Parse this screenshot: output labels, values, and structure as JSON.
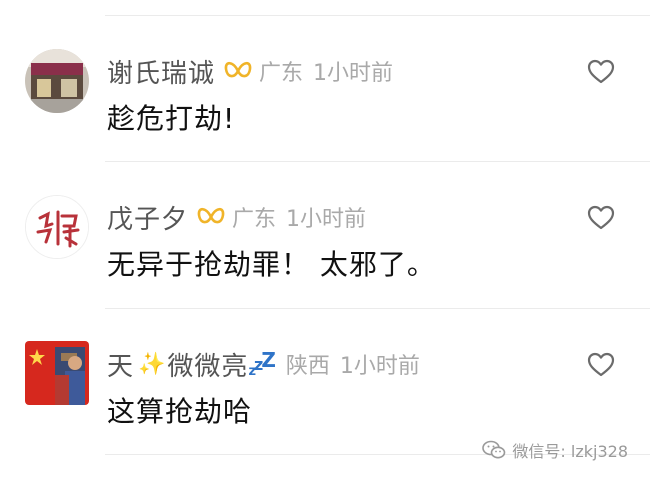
{
  "comments": [
    {
      "name": "谢氏瑞诚",
      "badge": "gold-ring-badge-icon",
      "location": "广东",
      "time": "1小时前",
      "text": "趁危打劫!"
    },
    {
      "name": "戊子夕",
      "badge": "gold-ring-badge-icon",
      "location": "广东",
      "time": "1小时前",
      "text": "无异于抢劫罪！ 太邪了。"
    },
    {
      "name_prefix": "天",
      "name_emoji": "✨",
      "name_main": "微微亮",
      "name_suffix_icon": "zzz-sleep-icon",
      "location": "陕西",
      "time": "1小时前",
      "text": "这算抢劫哈"
    }
  ],
  "watermark": {
    "icon": "wechat-icon",
    "text": "微信号: lzkj328"
  },
  "colors": {
    "name": "#555555",
    "meta": "#a9a9a9",
    "text": "#111111",
    "badge": "#f0b429",
    "divider": "#ebebeb"
  }
}
